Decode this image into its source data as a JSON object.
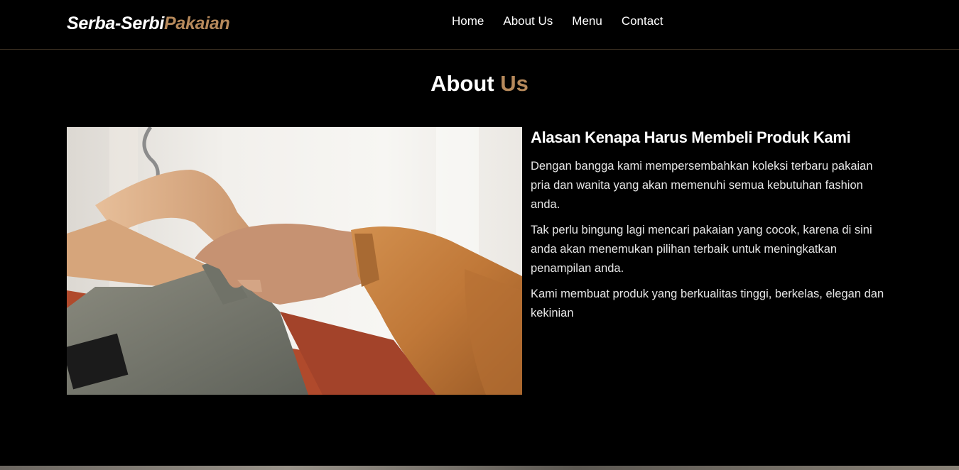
{
  "brand": {
    "main": "Serba-Serbi",
    "accent": "Pakaian"
  },
  "nav": {
    "items": [
      "Home",
      "About Us",
      "Menu",
      "Contact"
    ]
  },
  "about": {
    "title_main": "About",
    "title_accent": "Us",
    "heading": "Alasan Kenapa Harus Membeli Produk Kami",
    "paragraphs": [
      "Dengan bangga kami mempersembahkan koleksi terbaru pakaian pria dan wanita yang akan memenuhi semua kebutuhan fashion anda.",
      "Tak perlu bingung lagi mencari pakaian yang cocok, karena di sini anda akan menemukan pilihan terbaik untuk meningkatkan penampilan anda.",
      "Kami membuat produk yang berkualitas tinggi, berkelas, elegan dan kekinian"
    ]
  },
  "colors": {
    "background": "#000000",
    "accent": "#b6895b",
    "text": "#ffffff"
  }
}
